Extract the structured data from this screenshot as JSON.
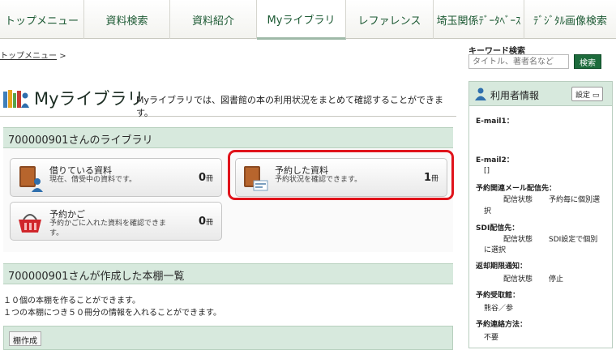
{
  "nav": {
    "items": [
      "トップメニュー",
      "資料検索",
      "資料紹介",
      "Myライブラリ",
      "レファレンス",
      "埼玉関係ﾃﾞｰﾀﾍﾞｰｽ",
      "ﾃﾞｼﾞﾀﾙ画像検索"
    ]
  },
  "breadcrumb": {
    "link": "トップメニュー",
    "sep": ">"
  },
  "keyword": {
    "label": "キーワード検索",
    "placeholder": "タイトル、著者名など",
    "button": "検索"
  },
  "page": {
    "title": "Myライブラリ",
    "subtitle": "Myライブラリでは、図書館の本の利用状況をまとめて確認することができます。"
  },
  "library": {
    "header": "700000901さんのライブラリ",
    "cards": {
      "borrowed": {
        "title": "借りている資料",
        "desc": "現在、借受中の資料です。",
        "count": "0",
        "unit": "冊"
      },
      "reserved": {
        "title": "予約した資料",
        "desc": "予約状況を確認できます。",
        "count": "1",
        "unit": "冊"
      },
      "basket": {
        "title": "予約かご",
        "desc": "予約かごに入れた資料を確認できます。",
        "count": "0",
        "unit": "冊"
      }
    }
  },
  "shelf": {
    "header": "700000901さんが作成した本棚一覧",
    "note1": "１０個の本棚を作ることができます。",
    "note2": "１つの本棚につき５０冊分の情報を入れることができます。",
    "create_button": "棚作成"
  },
  "user_info": {
    "title": "利用者情報",
    "settings_button": "設定",
    "email1_label": "E-mail1：",
    "email2_label": "E-mail2：",
    "email2_value": "[]",
    "mail_dest_label": "予約関連メール配信先：",
    "mail_status_label": "配信状態",
    "mail_status_value1": "予約毎に個別選",
    "mail_status_value2": "択",
    "sdi_label": "SDI配信先：",
    "sdi_status_label": "配信状態",
    "sdi_status_value1": "SDI設定で個別",
    "sdi_status_value2": "に選択",
    "overdue_label": "返却期限通知：",
    "overdue_status_label": "配信状態",
    "overdue_status_value": "停止",
    "pickup_label": "予約受取館：",
    "pickup_value": "熊谷／参",
    "contact_label": "予約連絡方法：",
    "contact_value": "不要"
  },
  "colors": {
    "accent": "#1d6b3c",
    "section_bg": "#d7e9dd",
    "highlight": "#e0131b"
  }
}
